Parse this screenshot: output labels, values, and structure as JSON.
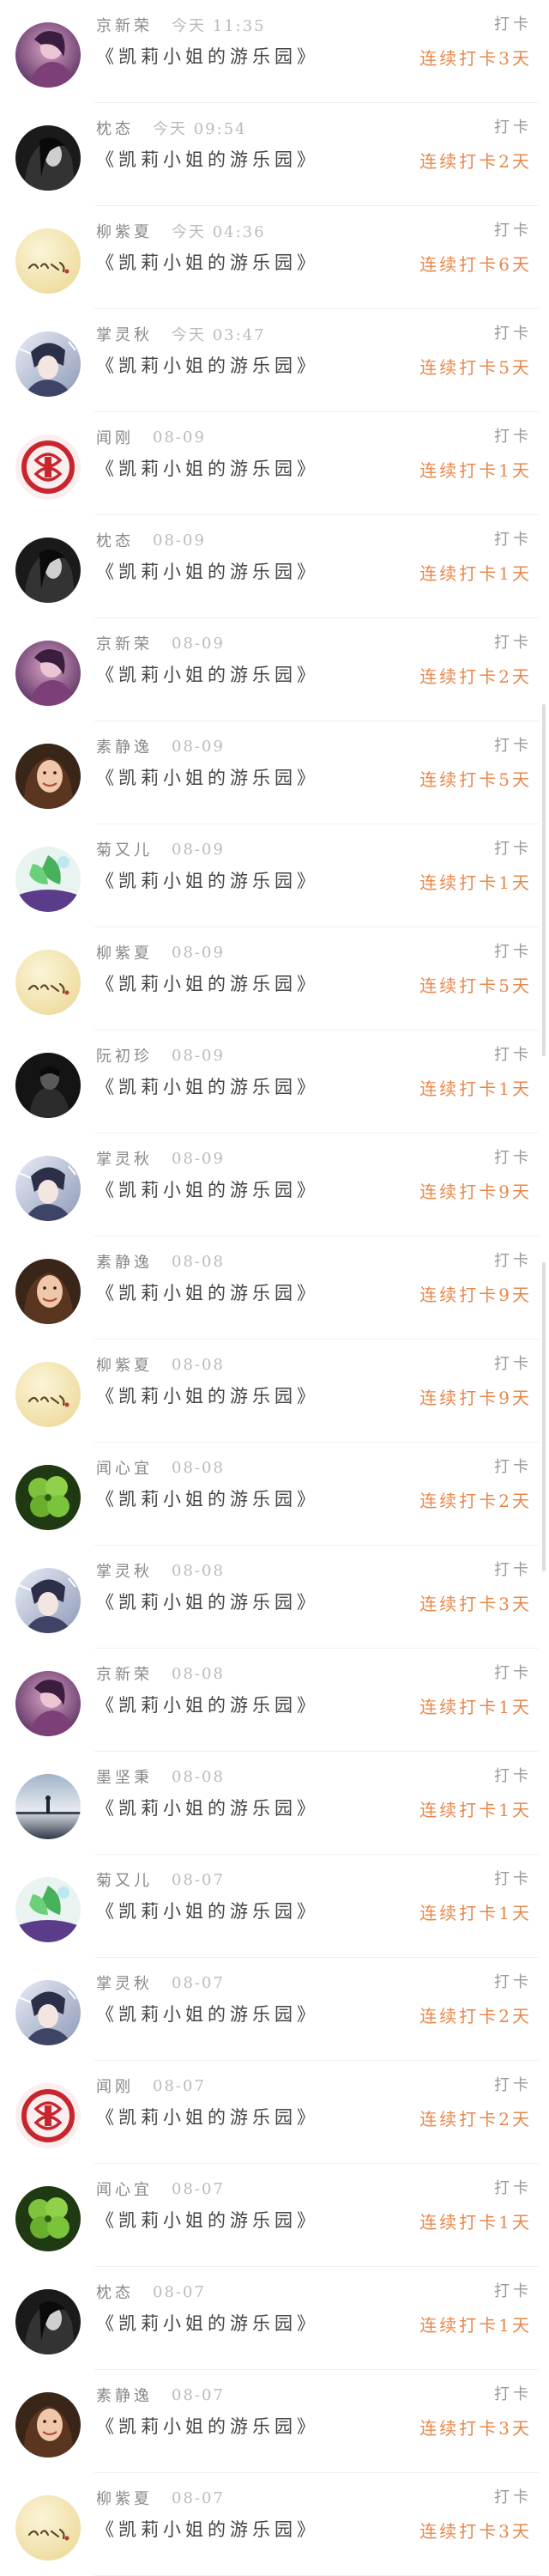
{
  "theme": {
    "streak_color": "#e8874a"
  },
  "feed": {
    "items": [
      {
        "user": "京新荣",
        "time": "今天 11:35",
        "book": "《凯莉小姐的游乐园》",
        "action": "打卡",
        "streak": "连续打卡3天",
        "avatar": "purple-portrait"
      },
      {
        "user": "枕态",
        "time": "今天 09:54",
        "book": "《凯莉小姐的游乐园》",
        "action": "打卡",
        "streak": "连续打卡2天",
        "avatar": "dark-hair-portrait"
      },
      {
        "user": "柳紫夏",
        "time": "今天 04:36",
        "book": "《凯莉小姐的游乐园》",
        "action": "打卡",
        "streak": "连续打卡6天",
        "avatar": "cream-calligraphy"
      },
      {
        "user": "掌灵秋",
        "time": "今天 03:47",
        "book": "《凯莉小姐的游乐园》",
        "action": "打卡",
        "streak": "连续打卡5天",
        "avatar": "anime-boy"
      },
      {
        "user": "闻刚",
        "time": "08-09",
        "book": "《凯莉小姐的游乐园》",
        "action": "打卡",
        "streak": "连续打卡1天",
        "avatar": "red-fu-charm"
      },
      {
        "user": "枕态",
        "time": "08-09",
        "book": "《凯莉小姐的游乐园》",
        "action": "打卡",
        "streak": "连续打卡1天",
        "avatar": "dark-hair-portrait"
      },
      {
        "user": "京新荣",
        "time": "08-09",
        "book": "《凯莉小姐的游乐园》",
        "action": "打卡",
        "streak": "连续打卡2天",
        "avatar": "purple-portrait"
      },
      {
        "user": "素静逸",
        "time": "08-09",
        "book": "《凯莉小姐的游乐园》",
        "action": "打卡",
        "streak": "连续打卡5天",
        "avatar": "smiling-woman"
      },
      {
        "user": "菊又儿",
        "time": "08-09",
        "book": "《凯莉小姐的游乐园》",
        "action": "打卡",
        "streak": "连续打卡1天",
        "avatar": "green-leaf-purple"
      },
      {
        "user": "柳紫夏",
        "time": "08-09",
        "book": "《凯莉小姐的游乐园》",
        "action": "打卡",
        "streak": "连续打卡5天",
        "avatar": "cream-calligraphy"
      },
      {
        "user": "阮初珍",
        "time": "08-09",
        "book": "《凯莉小姐的游乐园》",
        "action": "打卡",
        "streak": "连续打卡1天",
        "avatar": "dark-man"
      },
      {
        "user": "掌灵秋",
        "time": "08-09",
        "book": "《凯莉小姐的游乐园》",
        "action": "打卡",
        "streak": "连续打卡9天",
        "avatar": "anime-boy"
      },
      {
        "user": "素静逸",
        "time": "08-08",
        "book": "《凯莉小姐的游乐园》",
        "action": "打卡",
        "streak": "连续打卡9天",
        "avatar": "smiling-woman"
      },
      {
        "user": "柳紫夏",
        "time": "08-08",
        "book": "《凯莉小姐的游乐园》",
        "action": "打卡",
        "streak": "连续打卡9天",
        "avatar": "cream-calligraphy"
      },
      {
        "user": "闻心宜",
        "time": "08-08",
        "book": "《凯莉小姐的游乐园》",
        "action": "打卡",
        "streak": "连续打卡2天",
        "avatar": "clover"
      },
      {
        "user": "掌灵秋",
        "time": "08-08",
        "book": "《凯莉小姐的游乐园》",
        "action": "打卡",
        "streak": "连续打卡3天",
        "avatar": "anime-boy"
      },
      {
        "user": "京新荣",
        "time": "08-08",
        "book": "《凯莉小姐的游乐园》",
        "action": "打卡",
        "streak": "连续打卡1天",
        "avatar": "purple-portrait"
      },
      {
        "user": "墨坚秉",
        "time": "08-08",
        "book": "《凯莉小姐的游乐园》",
        "action": "打卡",
        "streak": "连续打卡1天",
        "avatar": "sunset-lake"
      },
      {
        "user": "菊又儿",
        "time": "08-07",
        "book": "《凯莉小姐的游乐园》",
        "action": "打卡",
        "streak": "连续打卡1天",
        "avatar": "green-leaf-purple"
      },
      {
        "user": "掌灵秋",
        "time": "08-07",
        "book": "《凯莉小姐的游乐园》",
        "action": "打卡",
        "streak": "连续打卡2天",
        "avatar": "anime-boy"
      },
      {
        "user": "闻刚",
        "time": "08-07",
        "book": "《凯莉小姐的游乐园》",
        "action": "打卡",
        "streak": "连续打卡2天",
        "avatar": "red-fu-charm"
      },
      {
        "user": "闻心宜",
        "time": "08-07",
        "book": "《凯莉小姐的游乐园》",
        "action": "打卡",
        "streak": "连续打卡1天",
        "avatar": "clover"
      },
      {
        "user": "枕态",
        "time": "08-07",
        "book": "《凯莉小姐的游乐园》",
        "action": "打卡",
        "streak": "连续打卡1天",
        "avatar": "dark-hair-portrait"
      },
      {
        "user": "素静逸",
        "time": "08-07",
        "book": "《凯莉小姐的游乐园》",
        "action": "打卡",
        "streak": "连续打卡3天",
        "avatar": "smiling-woman"
      },
      {
        "user": "柳紫夏",
        "time": "08-07",
        "book": "《凯莉小姐的游乐园》",
        "action": "打卡",
        "streak": "连续打卡3天",
        "avatar": "cream-calligraphy"
      }
    ]
  }
}
